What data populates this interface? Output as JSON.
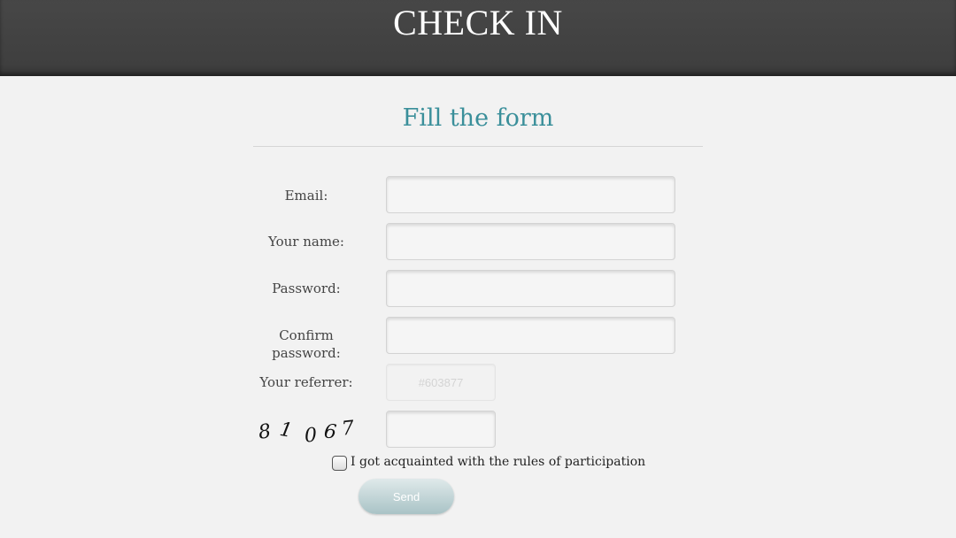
{
  "header": {
    "title": "CHECK IN"
  },
  "form": {
    "heading": "Fill the form",
    "fields": {
      "email": {
        "label": "Email:",
        "value": ""
      },
      "name": {
        "label": "Your name:",
        "value": ""
      },
      "password": {
        "label": "Password:",
        "value": ""
      },
      "confirm": {
        "label_line1": "Confirm",
        "label_line2": "password:",
        "value": ""
      },
      "referrer": {
        "label": "Your referrer:",
        "placeholder": "#603877"
      },
      "captcha": {
        "digits": [
          "8",
          "1",
          "0",
          "6",
          "7"
        ],
        "value": ""
      }
    },
    "rules_checkbox": {
      "label": "I got acquainted with the rules of participation",
      "checked": false
    },
    "submit": {
      "label": "Send"
    }
  }
}
